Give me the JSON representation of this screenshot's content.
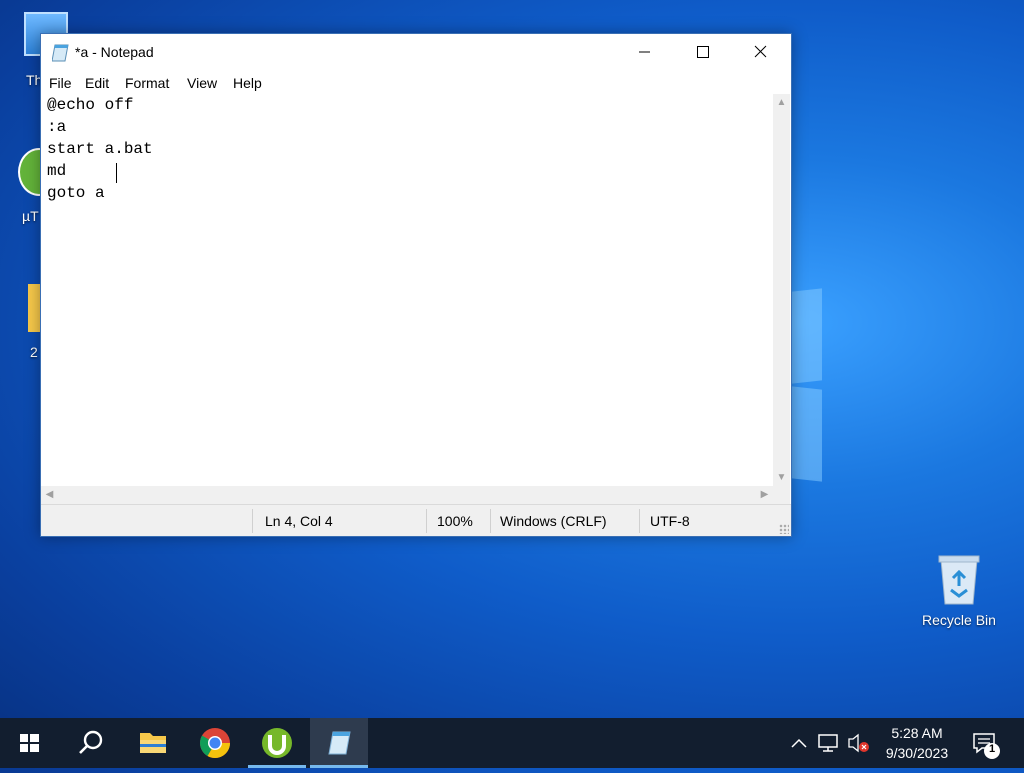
{
  "window": {
    "title": "*a - Notepad",
    "menu": [
      "File",
      "Edit",
      "Format",
      "View",
      "Help"
    ]
  },
  "editor": {
    "lines": [
      "@echo off",
      ":a",
      "start a.bat",
      "md ",
      "goto a"
    ]
  },
  "status": {
    "position": "Ln 4, Col 4",
    "zoom": "100%",
    "line_ending": "Windows (CRLF)",
    "encoding": "UTF-8"
  },
  "desktop": {
    "recycle_bin_label": "Recycle Bin",
    "partial_labels": [
      "Th",
      "µT",
      "2"
    ]
  },
  "taskbar": {
    "time": "5:28 AM",
    "date": "9/30/2023",
    "notification_count": "1",
    "pinned": [
      "start",
      "search",
      "file-explorer",
      "chrome",
      "utorrent",
      "notepad"
    ]
  },
  "colors": {
    "taskbar": "#121e2f",
    "accent": "#76b9ed"
  }
}
